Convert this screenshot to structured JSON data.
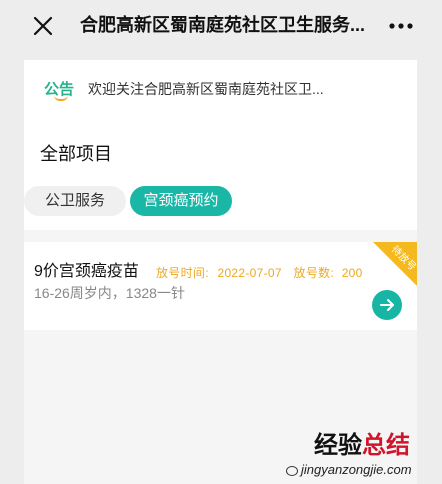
{
  "header": {
    "title": "合肥高新区蜀南庭苑社区卫生服务...",
    "close_icon": "close-icon",
    "more_icon": "more-icon"
  },
  "notice": {
    "badge_label": "公告",
    "text": "欢迎关注合肥高新区蜀南庭苑社区卫..."
  },
  "main": {
    "section_title": "全部项目",
    "tabs": [
      {
        "label": "公卫服务",
        "active": false
      },
      {
        "label": "宫颈癌预约",
        "active": true
      }
    ]
  },
  "card": {
    "title": "9价宫颈癌疫苗",
    "release_time_label": "放号时间:",
    "release_time_value": "2022-07-07",
    "release_count_label": "放号数:",
    "release_count_value": "200",
    "description": "16-26周岁内，1328一针",
    "ribbon_label": "待放号",
    "go_icon": "arrow-right-icon"
  },
  "watermark": {
    "brand_part1": "经验",
    "brand_part2": "总结",
    "url": "jingyanzongjie.com"
  },
  "colors": {
    "accent_teal": "#1ab6a6",
    "accent_orange": "#f0a81e",
    "ribbon_yellow": "#f5b920",
    "notice_green": "#27b48c"
  }
}
